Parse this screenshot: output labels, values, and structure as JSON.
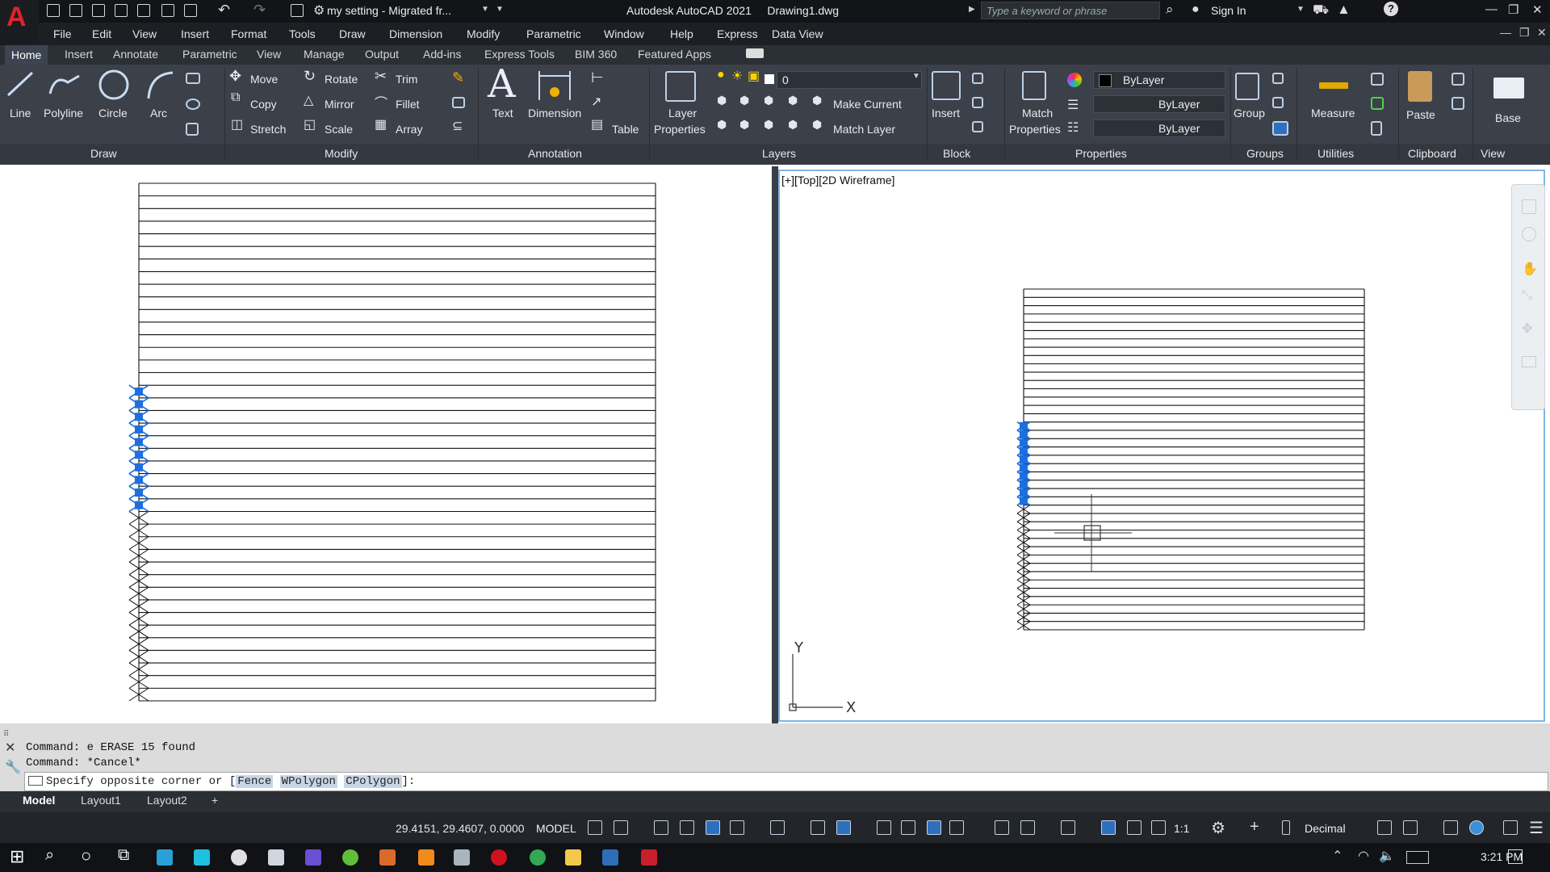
{
  "titlebar": {
    "workspace": "my setting - Migrated fr...",
    "app_title": "Autodesk AutoCAD 2021",
    "drawing_name": "Drawing1.dwg",
    "search_placeholder": "Type a keyword or phrase",
    "sign_in": "Sign In",
    "logo": "A"
  },
  "menubar": [
    "File",
    "Edit",
    "View",
    "Insert",
    "Format",
    "Tools",
    "Draw",
    "Dimension",
    "Modify",
    "Parametric",
    "Window",
    "Help",
    "Express",
    "Data View"
  ],
  "ribbon_tabs": [
    "Home",
    "Insert",
    "Annotate",
    "Parametric",
    "View",
    "Manage",
    "Output",
    "Add-ins",
    "Express Tools",
    "BIM 360",
    "Featured Apps"
  ],
  "ribbon_active_tab": "Home",
  "draw_panel": {
    "title": "Draw",
    "line": "Line",
    "polyline": "Polyline",
    "circle": "Circle",
    "arc": "Arc"
  },
  "modify_panel": {
    "title": "Modify",
    "move": "Move",
    "rotate": "Rotate",
    "trim": "Trim",
    "copy": "Copy",
    "mirror": "Mirror",
    "fillet": "Fillet",
    "stretch": "Stretch",
    "scale": "Scale",
    "array": "Array"
  },
  "annotation_panel": {
    "title": "Annotation",
    "text": "Text",
    "dimension": "Dimension",
    "table": "Table"
  },
  "layers_panel": {
    "title": "Layers",
    "layer_properties_1": "Layer",
    "layer_properties_2": "Properties",
    "current_layer": "0",
    "make_current": "Make Current",
    "match_layer": "Match Layer"
  },
  "block_panel": {
    "title": "Block",
    "insert": "Insert"
  },
  "properties_panel": {
    "title": "Properties",
    "match_1": "Match",
    "match_2": "Properties",
    "color": "ByLayer",
    "linetype": "ByLayer",
    "lineweight": "ByLayer"
  },
  "groups_panel": {
    "title": "Groups",
    "group": "Group"
  },
  "utilities_panel": {
    "title": "Utilities",
    "measure": "Measure"
  },
  "clipboard_panel": {
    "title": "Clipboard",
    "paste": "Paste"
  },
  "view_panel": {
    "title": "View",
    "base": "Base"
  },
  "viewport": {
    "label": "[+][Top][2D Wireframe]",
    "ucs_x": "X",
    "ucs_y": "Y"
  },
  "command": {
    "history": [
      "Command: e ERASE 15 found",
      "Command: *Cancel*"
    ],
    "prompt_text": "Specify opposite corner or [",
    "options": [
      "Fence",
      "WPolygon",
      "CPolygon"
    ],
    "prompt_end": "]:"
  },
  "layout_tabs": [
    "Model",
    "Layout1",
    "Layout2"
  ],
  "layout_add": "+",
  "status": {
    "coords": "29.4151, 29.4607, 0.0000",
    "space": "MODEL",
    "scale": "1:1",
    "units": "Decimal"
  },
  "taskbar": {
    "time": "3:21 PM"
  },
  "colors": {
    "selection_blue": "#1d6fe0",
    "viewport_border": "#7fb6e8",
    "ribbon_bg": "#3b4049"
  }
}
